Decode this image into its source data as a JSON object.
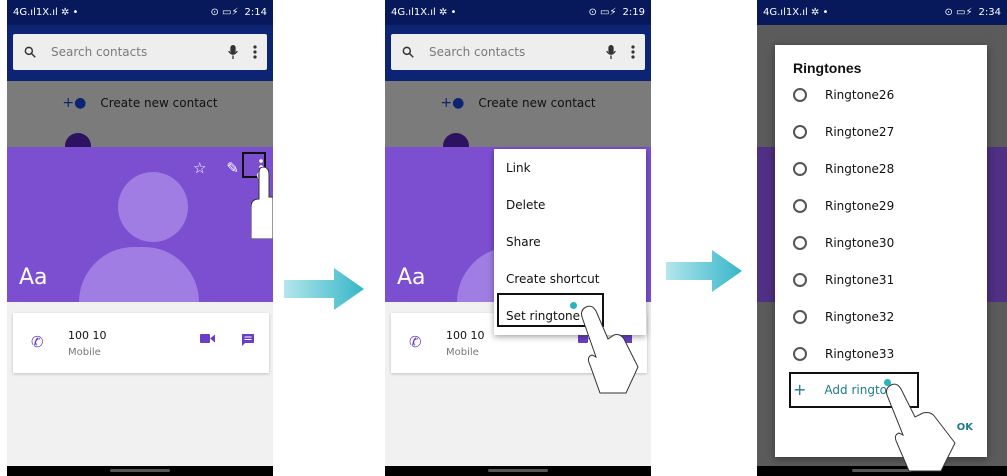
{
  "status": {
    "left": "4G.ıl1X.ıl ✲  •",
    "icons": "⊙ ▭⚡",
    "time1": "2:14",
    "time2": "2:19",
    "time3": "2:34"
  },
  "search": {
    "placeholder": "Search contacts"
  },
  "create_contact": "Create new contact",
  "contact": {
    "name": "Aa",
    "number": "100 10",
    "type": "Mobile"
  },
  "menu": {
    "items": [
      "Link",
      "Delete",
      "Share",
      "Create shortcut",
      "Set ringtone"
    ]
  },
  "ringtones": {
    "title": "Ringtones",
    "items": [
      "Ringtone26",
      "Ringtone27",
      "Ringtone28",
      "Ringtone29",
      "Ringtone30",
      "Ringtone31",
      "Ringtone32",
      "Ringtone33"
    ],
    "add_label": "Add ringtone",
    "ok_label": "OK"
  },
  "icons": {
    "search": "search-icon",
    "mic": "mic-icon",
    "more": "more-vert-icon",
    "star": "star-icon",
    "edit": "edit-icon",
    "phone": "phone-icon",
    "video": "video-icon",
    "message": "message-icon",
    "add_person": "add-person-icon",
    "arrow": "right-arrow-icon",
    "hand": "tap-hand-icon"
  },
  "colors": {
    "appbar": "#0d2373",
    "hero": "#7c4fd1",
    "accent": "#6a3fc6",
    "teal": "#2bb3c0"
  }
}
